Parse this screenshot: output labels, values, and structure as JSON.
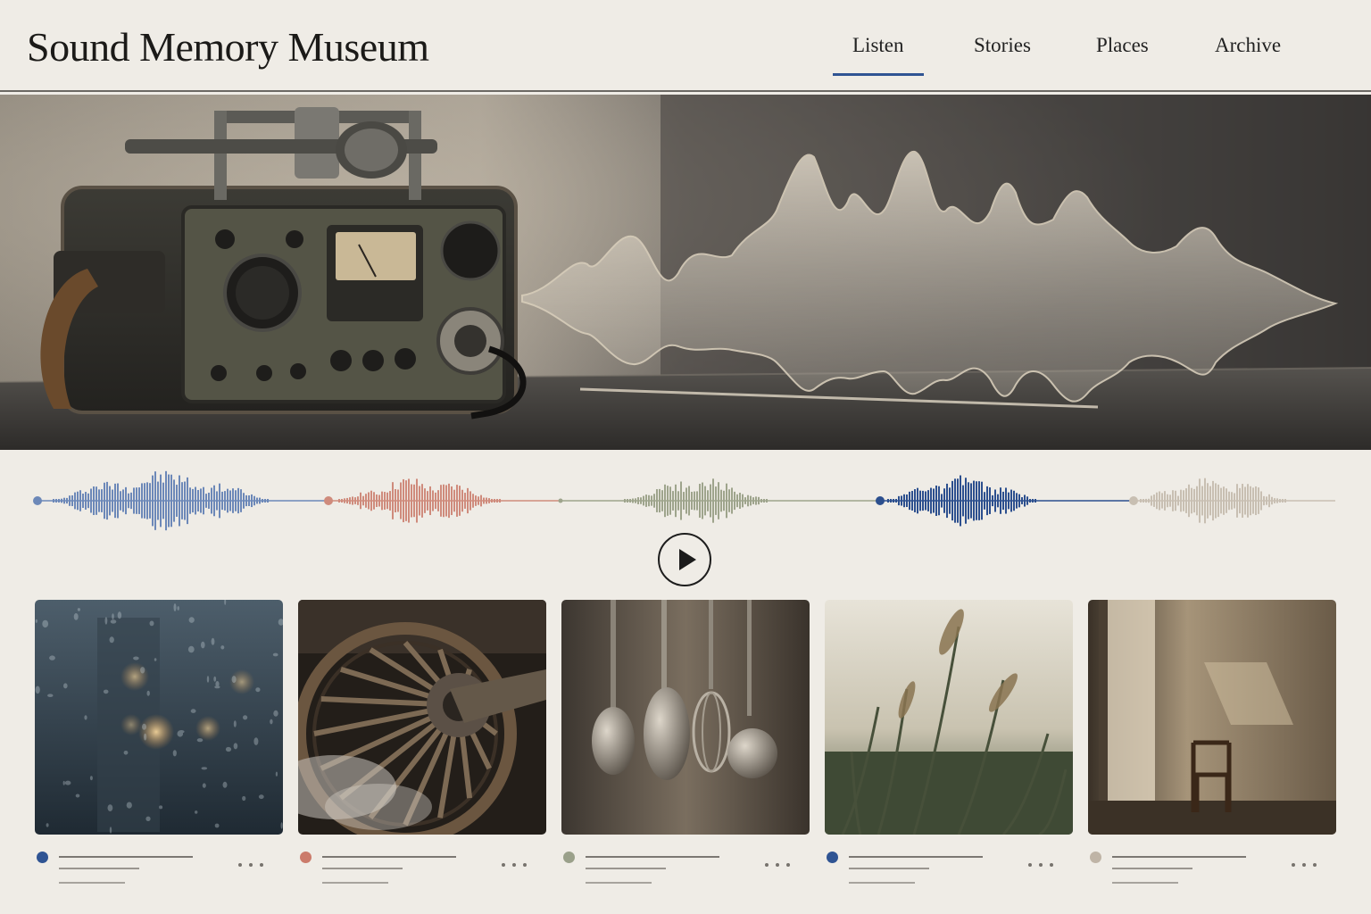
{
  "header": {
    "title": "Sound Memory Museum",
    "nav": [
      {
        "label": "Listen",
        "active": true
      },
      {
        "label": "Stories",
        "active": false
      },
      {
        "label": "Places",
        "active": false
      },
      {
        "label": "Archive",
        "active": false
      }
    ],
    "accent_color": "#2f5493"
  },
  "hero": {
    "image": "vintage-radio-recorder-and-glass-soundwave-sculpture",
    "icon": "hero-photo"
  },
  "waveforms": [
    {
      "color": "#6c88b8"
    },
    {
      "color": "#cf8b7c"
    },
    {
      "color": "#9ea48c"
    },
    {
      "color": "#2c4f8e"
    },
    {
      "color": "#c8bfb2"
    }
  ],
  "player": {
    "icon": "play-icon"
  },
  "cards": [
    {
      "image": "rain-on-window",
      "dot_color": "#2f5493",
      "more_icon": "more-dots-icon"
    },
    {
      "image": "steam-train-wheel",
      "dot_color": "#cb7b6b",
      "more_icon": "more-dots-icon"
    },
    {
      "image": "hanging-kitchen-utensils",
      "dot_color": "#9aa08a",
      "more_icon": "more-dots-icon"
    },
    {
      "image": "reeds-in-wind",
      "dot_color": "#2f5493",
      "more_icon": "more-dots-icon"
    },
    {
      "image": "empty-room-with-chair",
      "dot_color": "#bfb4a6",
      "more_icon": "more-dots-icon"
    }
  ]
}
